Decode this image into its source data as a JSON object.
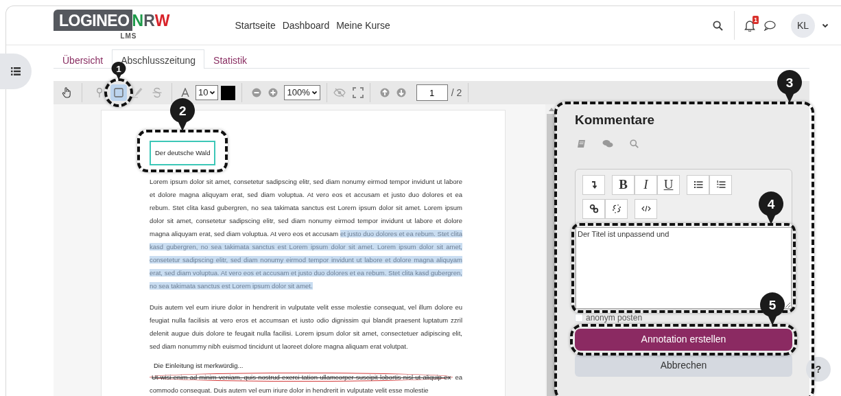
{
  "header": {
    "logo": {
      "text": "LOGINEO",
      "accents": [
        {
          "text": "N",
          "color": "#1e9a4a"
        },
        {
          "text": "R",
          "color": "#55585e"
        },
        {
          "text": "W",
          "color": "#d8232a"
        }
      ],
      "subtitle": "LMS"
    },
    "nav_links": [
      "Startseite",
      "Dashboard",
      "Meine Kurse"
    ],
    "notification_count": "1",
    "avatar": "KL"
  },
  "tabs": [
    {
      "label": "Übersicht",
      "selected": false
    },
    {
      "label": "Abschlusszeitung",
      "selected": true
    },
    {
      "label": "Statistik",
      "selected": false
    }
  ],
  "toolbar": {
    "tools": [
      {
        "selected": false
      },
      {
        "selected": false
      },
      {
        "selected": true
      },
      {
        "selected": false
      },
      {
        "selected": false
      }
    ],
    "font_size": "10",
    "zoom": "100%",
    "page": "1",
    "page_count": "/ 2"
  },
  "document": {
    "title_annotation": "Der deutsche Wald",
    "paragraphs": [
      {
        "segments": [
          {
            "text": "Lorem ipsum dolor sit amet, consetetur sadipscing elitr, sed diam nonumy eirmod tempor invidunt ut labore et dolore magna aliquyam erat, sed diam voluptua. At vero eos et accusam et justo duo dolores et ea rebum. Stet clita kasd gubergren, no sea takimata sanctus est Lorem ipsum dolor sit amet. Lorem ipsum dolor sit amet, consetetur sadipscing elitr, sed diam nonumy eirmod tempor invidunt ut labore et dolore magna aliquyam erat, sed diam voluptua. At vero eos et accusam ",
            "highlighted": false,
            "struck": false
          },
          {
            "text": "et justo duo dolores et ea rebum. Stet clita kasd gubergren, no sea takimata sanctus est Lorem ipsum dolor sit amet. Lorem ipsum dolor sit amet, consetetur sadipscing elitr, sed diam nonumy eirmod tempor invidunt ut labore et dolore magna aliquyam erat, sed diam voluptua. At vero eos et accusam et justo duo dolores et ea rebum. Stet clita kasd gubergren, no sea takimata sanctus est Lorem ipsum dolor sit amet.",
            "highlighted": true,
            "struck": false
          }
        ]
      },
      {
        "segments": [
          {
            "text": "Duis autem vel eum iriure dolor in hendrerit in vulputate velit esse molestie consequat, vel illum dolore eu feugiat nulla facilisis at vero eros et accumsan et iusto odio dignissim qui blandit praesent luptatum zzril delenit augue duis dolore te feugait nulla facilisi. Lorem ipsum dolor sit amet, consectetuer adipiscing elit, sed diam nonummy nibh euismod tincidunt ut laoreet dolore magna aliquam erat volutpat.",
            "highlighted": false,
            "struck": false
          }
        ]
      },
      {
        "note": "Die Einleitung ist merkwürdig...",
        "segments": [
          {
            "text": "Ut wisi enim ad minim veniam, quis nostrud exerci tation ullamcorper suscipit lobortis nisl ut aliquip ex",
            "highlighted": false,
            "struck": true
          },
          {
            "text": " ea commodo consequat. Duis autem vel eum iriure dolor in hendrerit in vulputate velit esse molestie",
            "highlighted": false,
            "struck": false
          }
        ]
      }
    ]
  },
  "comments_panel": {
    "title": "Kommentare",
    "format_buttons": [
      "B",
      "I",
      "U"
    ],
    "comment": "Der Titel ist unpassend und",
    "anonymous": {
      "label": "anonym posten",
      "checked": false
    },
    "submit": "Annotation erstellen",
    "cancel": "Abbrechen"
  },
  "help": "?",
  "callouts": [
    {
      "number": "1"
    },
    {
      "number": "2"
    },
    {
      "number": "3"
    },
    {
      "number": "4"
    },
    {
      "number": "5"
    }
  ]
}
